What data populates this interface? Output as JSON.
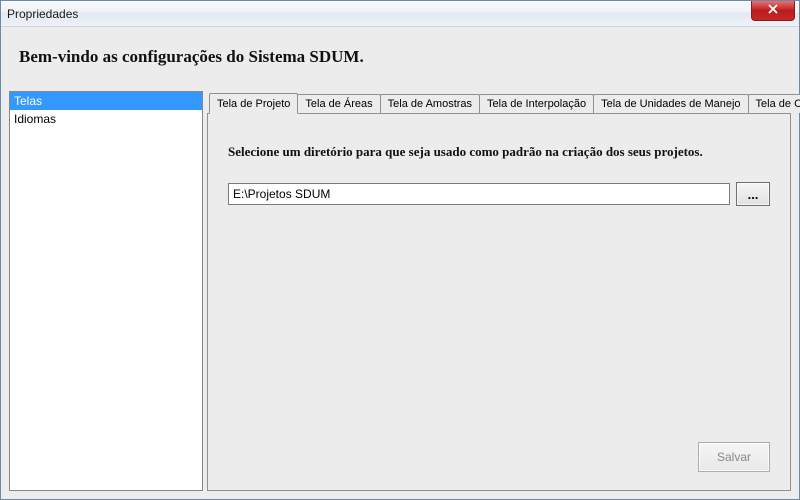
{
  "window": {
    "title": "Propriedades"
  },
  "heading": "Bem-vindo as configurações do Sistema SDUM.",
  "sidebar": {
    "items": [
      {
        "label": "Telas",
        "selected": true
      },
      {
        "label": "Idiomas",
        "selected": false
      }
    ]
  },
  "tabs": [
    {
      "label": "Tela de Projeto",
      "active": true
    },
    {
      "label": "Tela de Áreas",
      "active": false
    },
    {
      "label": "Tela de Amostras",
      "active": false
    },
    {
      "label": "Tela de Interpolação",
      "active": false
    },
    {
      "label": "Tela de Unidades de Manejo",
      "active": false
    },
    {
      "label": "Tela de Correlação",
      "active": false
    }
  ],
  "panel": {
    "instruction": "Selecione um diretório para que seja usado como padrão na criação dos seus projetos.",
    "path_value": "E:\\Projetos SDUM",
    "browse_label": "...",
    "save_label": "Salvar"
  }
}
